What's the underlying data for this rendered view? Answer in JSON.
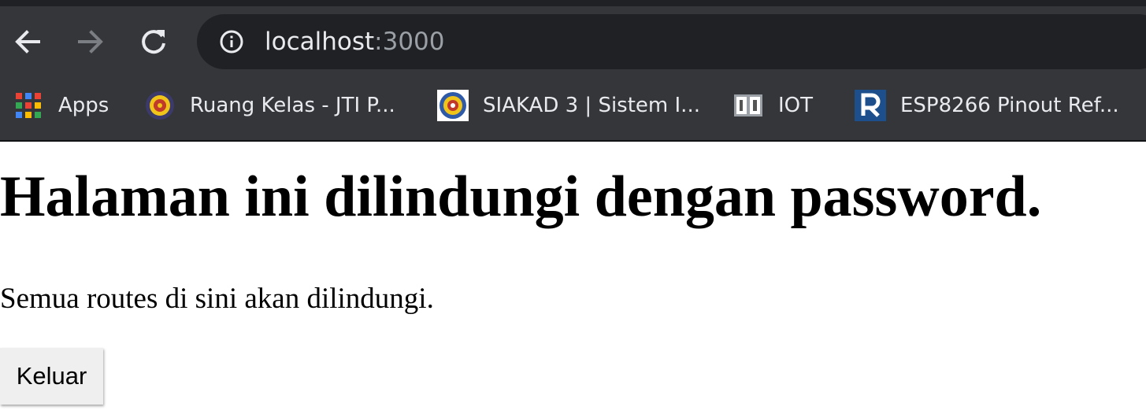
{
  "browser": {
    "url_host": "localhost",
    "url_port": ":3000",
    "bookmarks": [
      {
        "label": "Apps",
        "icon": "apps-grid-icon"
      },
      {
        "label": "Ruang Kelas - JTI P...",
        "icon": "university-seal-icon"
      },
      {
        "label": "SIAKAD 3 | Sistem I...",
        "icon": "university-seal-icon"
      },
      {
        "label": "IOT",
        "icon": "book-icon"
      },
      {
        "label": "ESP8266 Pinout Ref...",
        "icon": "r-letter-icon"
      }
    ]
  },
  "page": {
    "heading": "Halaman ini dilindungi dengan password.",
    "description": "Semua routes di sini akan dilindungi.",
    "logout_label": "Keluar"
  }
}
